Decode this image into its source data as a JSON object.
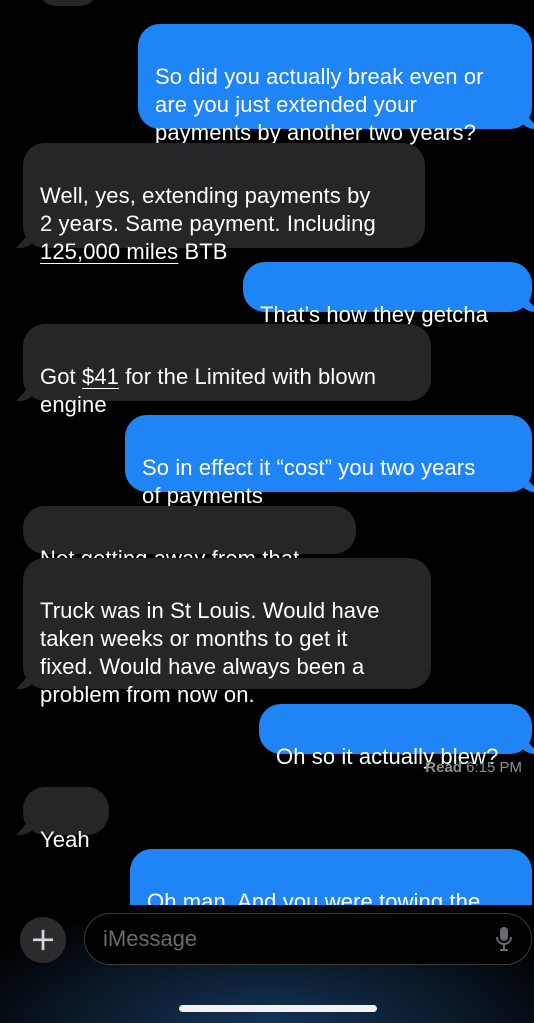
{
  "thread": {
    "messages": [
      {
        "direction": "outgoing",
        "text": "So did you actually break even or\nare you just extended your\npayments by another two years?"
      },
      {
        "direction": "incoming",
        "text_before": "Well, yes, extending payments by\n2 years. Same payment. Including\n",
        "link": "125,000 miles",
        "text_after": " BTB"
      },
      {
        "direction": "outgoing",
        "text": "That’s how they getcha"
      },
      {
        "direction": "incoming",
        "text_before": "Got ",
        "link": "$41",
        "text_after": " for the Limited with blown\nengine"
      },
      {
        "direction": "outgoing",
        "text": "So in effect it “cost” you two years\nof payments"
      },
      {
        "direction": "incoming",
        "text": "Not getting away from that."
      },
      {
        "direction": "incoming",
        "text": "Truck was in St Louis.  Would have\ntaken weeks or months to get it\nfixed. Would have always been a\nproblem from now on."
      },
      {
        "direction": "outgoing",
        "text": "Oh so it actually blew?"
      },
      {
        "direction": "incoming",
        "text": "Yeah"
      },
      {
        "direction": "outgoing",
        "text": "Oh man. And you were towing the\ncamper?"
      }
    ],
    "read_receipt": {
      "label": "Read",
      "time": "6:15 PM"
    }
  },
  "composer": {
    "plus_icon": "plus-icon",
    "plus_glyph": "+",
    "placeholder": "iMessage",
    "mic_icon": "microphone-icon"
  },
  "colors": {
    "outgoing_bubble": "#1f84f5",
    "incoming_bubble": "#262628",
    "background": "#000000"
  }
}
